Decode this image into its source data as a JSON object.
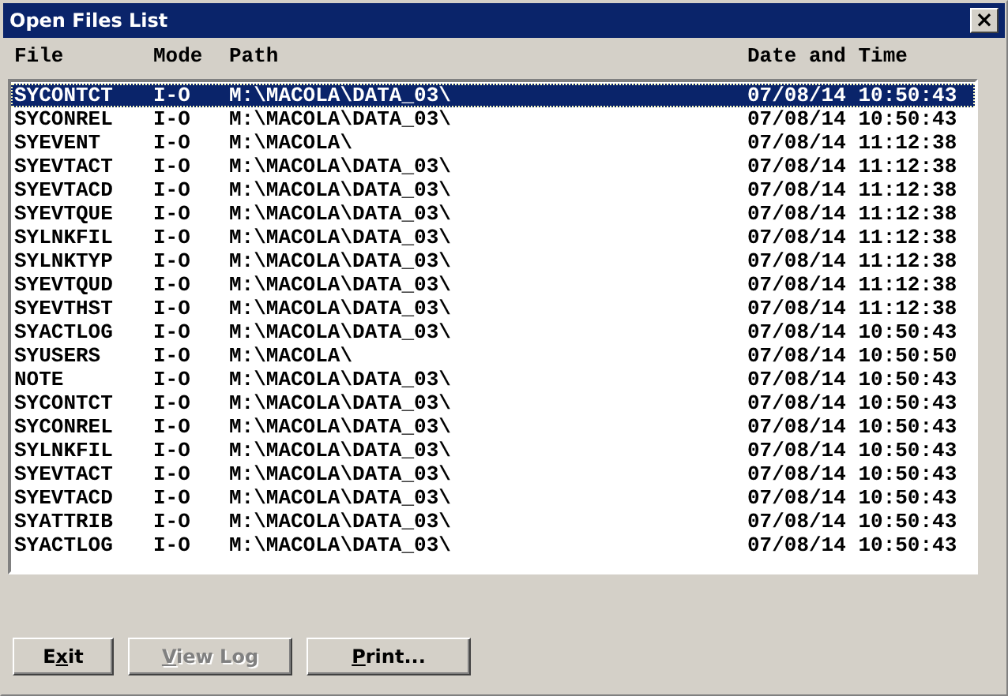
{
  "window": {
    "title": "Open Files List",
    "close": "×"
  },
  "columns": [
    "File",
    "Mode",
    "Path",
    "Date and Time"
  ],
  "rows": [
    {
      "file": "SYCONTCT",
      "mode": "I-O",
      "path": "M:\\MACOLA\\DATA_03\\",
      "datetime": "07/08/14 10:50:43",
      "selected": true
    },
    {
      "file": "SYCONREL",
      "mode": "I-O",
      "path": "M:\\MACOLA\\DATA_03\\",
      "datetime": "07/08/14 10:50:43",
      "selected": false
    },
    {
      "file": "SYEVENT",
      "mode": "I-O",
      "path": "M:\\MACOLA\\",
      "datetime": "07/08/14 11:12:38",
      "selected": false
    },
    {
      "file": "SYEVTACT",
      "mode": "I-O",
      "path": "M:\\MACOLA\\DATA_03\\",
      "datetime": "07/08/14 11:12:38",
      "selected": false
    },
    {
      "file": "SYEVTACD",
      "mode": "I-O",
      "path": "M:\\MACOLA\\DATA_03\\",
      "datetime": "07/08/14 11:12:38",
      "selected": false
    },
    {
      "file": "SYEVTQUE",
      "mode": "I-O",
      "path": "M:\\MACOLA\\DATA_03\\",
      "datetime": "07/08/14 11:12:38",
      "selected": false
    },
    {
      "file": "SYLNKFIL",
      "mode": "I-O",
      "path": "M:\\MACOLA\\DATA_03\\",
      "datetime": "07/08/14 11:12:38",
      "selected": false
    },
    {
      "file": "SYLNKTYP",
      "mode": "I-O",
      "path": "M:\\MACOLA\\DATA_03\\",
      "datetime": "07/08/14 11:12:38",
      "selected": false
    },
    {
      "file": "SYEVTQUD",
      "mode": "I-O",
      "path": "M:\\MACOLA\\DATA_03\\",
      "datetime": "07/08/14 11:12:38",
      "selected": false
    },
    {
      "file": "SYEVTHST",
      "mode": "I-O",
      "path": "M:\\MACOLA\\DATA_03\\",
      "datetime": "07/08/14 11:12:38",
      "selected": false
    },
    {
      "file": "SYACTLOG",
      "mode": "I-O",
      "path": "M:\\MACOLA\\DATA_03\\",
      "datetime": "07/08/14 10:50:43",
      "selected": false
    },
    {
      "file": "SYUSERS",
      "mode": "I-O",
      "path": "M:\\MACOLA\\",
      "datetime": "07/08/14 10:50:50",
      "selected": false
    },
    {
      "file": "NOTE",
      "mode": "I-O",
      "path": "M:\\MACOLA\\DATA_03\\",
      "datetime": "07/08/14 10:50:43",
      "selected": false
    },
    {
      "file": "SYCONTCT",
      "mode": "I-O",
      "path": "M:\\MACOLA\\DATA_03\\",
      "datetime": "07/08/14 10:50:43",
      "selected": false
    },
    {
      "file": "SYCONREL",
      "mode": "I-O",
      "path": "M:\\MACOLA\\DATA_03\\",
      "datetime": "07/08/14 10:50:43",
      "selected": false
    },
    {
      "file": "SYLNKFIL",
      "mode": "I-O",
      "path": "M:\\MACOLA\\DATA_03\\",
      "datetime": "07/08/14 10:50:43",
      "selected": false
    },
    {
      "file": "SYEVTACT",
      "mode": "I-O",
      "path": "M:\\MACOLA\\DATA_03\\",
      "datetime": "07/08/14 10:50:43",
      "selected": false
    },
    {
      "file": "SYEVTACD",
      "mode": "I-O",
      "path": "M:\\MACOLA\\DATA_03\\",
      "datetime": "07/08/14 10:50:43",
      "selected": false
    },
    {
      "file": "SYATTRIB",
      "mode": "I-O",
      "path": "M:\\MACOLA\\DATA_03\\",
      "datetime": "07/08/14 10:50:43",
      "selected": false
    },
    {
      "file": "SYACTLOG",
      "mode": "I-O",
      "path": "M:\\MACOLA\\DATA_03\\",
      "datetime": "07/08/14 10:50:43",
      "selected": false
    }
  ],
  "buttons": [
    {
      "before_key": "E",
      "key": "x",
      "after_key": "it",
      "disabled": false
    },
    {
      "key": "V",
      "after_key": "iew Log",
      "disabled": true
    },
    {
      "key": "P",
      "after_key": "rint...",
      "disabled": false
    }
  ]
}
